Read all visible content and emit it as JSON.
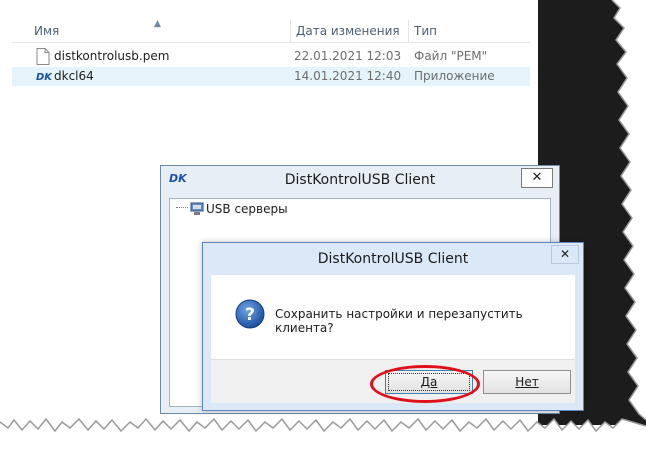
{
  "explorer": {
    "columns": {
      "name": "Имя",
      "date": "Дата изменения",
      "type": "Тип"
    },
    "files": [
      {
        "name": "distkontrolusb.pem",
        "date": "22.01.2021 12:03",
        "type": "Файл \"PEM\"",
        "icon": "document-icon"
      },
      {
        "name": "dkcl64",
        "date": "14.01.2021 12:40",
        "type": "Приложение",
        "icon": "dk-app-icon"
      }
    ]
  },
  "client_window": {
    "app_icon": "DK",
    "title": "DistKontrolUSB Client",
    "close": "✕",
    "tree_root": "USB серверы"
  },
  "dialog": {
    "title": "DistKontrolUSB Client",
    "close": "✕",
    "message": "Сохранить настройки и перезапустить клиента?",
    "yes_label": "Да",
    "no_label": "Нет"
  },
  "colors": {
    "highlight_oval": "#e0101a",
    "dialog_frame": "#dbe8f7",
    "selected_row": "#e5f3fb"
  }
}
